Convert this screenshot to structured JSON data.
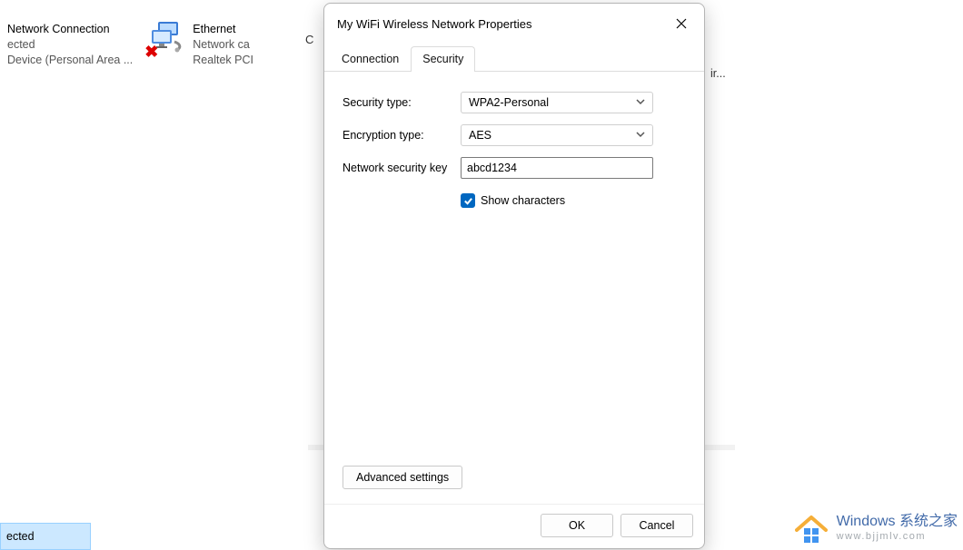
{
  "background": {
    "item1": {
      "title": "Network Connection",
      "line2": "ected",
      "line3": "Device (Personal Area ..."
    },
    "item2": {
      "title": "Ethernet",
      "line2": "Network ca",
      "line3": "Realtek PCI"
    },
    "partial_letter": "C",
    "right_truncated": "ir...",
    "selected_fragment": "ected"
  },
  "dialog": {
    "title": "My WiFi Wireless Network Properties",
    "tabs": {
      "connection": "Connection",
      "security": "Security"
    },
    "fields": {
      "security_type": {
        "label": "Security type:",
        "value": "WPA2-Personal"
      },
      "encryption_type": {
        "label": "Encryption type:",
        "value": "AES"
      },
      "network_key": {
        "label": "Network security key",
        "value": "abcd1234"
      },
      "show_characters": {
        "label": "Show characters",
        "checked": true
      }
    },
    "buttons": {
      "advanced": "Advanced settings",
      "ok": "OK",
      "cancel": "Cancel"
    }
  },
  "watermark": {
    "line1": "Windows 系统之家",
    "line2": "www.bjjmlv.com"
  }
}
